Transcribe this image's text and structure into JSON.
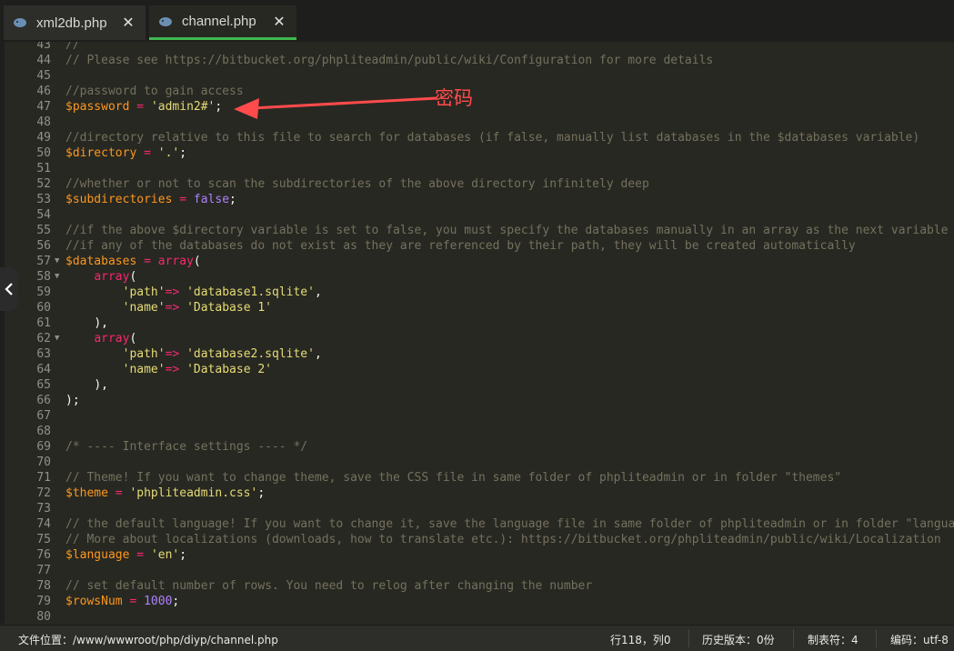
{
  "tabs": [
    {
      "label": "xml2db.php",
      "close": "✕",
      "active": false
    },
    {
      "label": "channel.php",
      "close": "✕",
      "active": true
    }
  ],
  "colors": {
    "accent": "#3fb950",
    "annotation": "#ff4b4b"
  },
  "annotation": {
    "text": "密码"
  },
  "lines": [
    {
      "n": "43",
      "fold": false,
      "segs": [
        {
          "c": "c",
          "t": "//"
        }
      ]
    },
    {
      "n": "44",
      "fold": false,
      "segs": [
        {
          "c": "c",
          "t": "// Please see https://bitbucket.org/phpliteadmin/public/wiki/Configuration for more details"
        }
      ]
    },
    {
      "n": "45",
      "fold": false,
      "segs": []
    },
    {
      "n": "46",
      "fold": false,
      "segs": [
        {
          "c": "c",
          "t": "//password to gain access"
        }
      ]
    },
    {
      "n": "47",
      "fold": false,
      "segs": [
        {
          "c": "v",
          "t": "$password"
        },
        {
          "c": "p",
          "t": " "
        },
        {
          "c": "o",
          "t": "="
        },
        {
          "c": "p",
          "t": " "
        },
        {
          "c": "s",
          "t": "'admin2#'"
        },
        {
          "c": "p",
          "t": ";"
        }
      ]
    },
    {
      "n": "48",
      "fold": false,
      "segs": []
    },
    {
      "n": "49",
      "fold": false,
      "segs": [
        {
          "c": "c",
          "t": "//directory relative to this file to search for databases (if false, manually list databases in the $databases variable)"
        }
      ]
    },
    {
      "n": "50",
      "fold": false,
      "segs": [
        {
          "c": "v",
          "t": "$directory"
        },
        {
          "c": "p",
          "t": " "
        },
        {
          "c": "o",
          "t": "="
        },
        {
          "c": "p",
          "t": " "
        },
        {
          "c": "s",
          "t": "'.'"
        },
        {
          "c": "p",
          "t": ";"
        }
      ]
    },
    {
      "n": "51",
      "fold": false,
      "segs": []
    },
    {
      "n": "52",
      "fold": false,
      "segs": [
        {
          "c": "c",
          "t": "//whether or not to scan the subdirectories of the above directory infinitely deep"
        }
      ]
    },
    {
      "n": "53",
      "fold": false,
      "segs": [
        {
          "c": "v",
          "t": "$subdirectories"
        },
        {
          "c": "p",
          "t": " "
        },
        {
          "c": "o",
          "t": "="
        },
        {
          "c": "p",
          "t": " "
        },
        {
          "c": "b",
          "t": "false"
        },
        {
          "c": "p",
          "t": ";"
        }
      ]
    },
    {
      "n": "54",
      "fold": false,
      "segs": []
    },
    {
      "n": "55",
      "fold": false,
      "segs": [
        {
          "c": "c",
          "t": "//if the above $directory variable is set to false, you must specify the databases manually in an array as the next variable"
        }
      ]
    },
    {
      "n": "56",
      "fold": false,
      "segs": [
        {
          "c": "c",
          "t": "//if any of the databases do not exist as they are referenced by their path, they will be created automatically"
        }
      ]
    },
    {
      "n": "57",
      "fold": true,
      "segs": [
        {
          "c": "v",
          "t": "$databases"
        },
        {
          "c": "p",
          "t": " "
        },
        {
          "c": "o",
          "t": "="
        },
        {
          "c": "p",
          "t": " "
        },
        {
          "c": "k",
          "t": "array"
        },
        {
          "c": "p",
          "t": "("
        }
      ]
    },
    {
      "n": "58",
      "fold": true,
      "segs": [
        {
          "c": "w",
          "t": "    "
        },
        {
          "c": "k",
          "t": "array"
        },
        {
          "c": "p",
          "t": "("
        }
      ]
    },
    {
      "n": "59",
      "fold": false,
      "segs": [
        {
          "c": "w",
          "t": "        "
        },
        {
          "c": "s",
          "t": "'path'"
        },
        {
          "c": "o",
          "t": "=>"
        },
        {
          "c": "p",
          "t": " "
        },
        {
          "c": "s",
          "t": "'database1.sqlite'"
        },
        {
          "c": "p",
          "t": ","
        }
      ]
    },
    {
      "n": "60",
      "fold": false,
      "segs": [
        {
          "c": "w",
          "t": "        "
        },
        {
          "c": "s",
          "t": "'name'"
        },
        {
          "c": "o",
          "t": "=>"
        },
        {
          "c": "p",
          "t": " "
        },
        {
          "c": "s",
          "t": "'Database 1'"
        }
      ]
    },
    {
      "n": "61",
      "fold": false,
      "segs": [
        {
          "c": "w",
          "t": "    "
        },
        {
          "c": "p",
          "t": "),"
        }
      ]
    },
    {
      "n": "62",
      "fold": true,
      "segs": [
        {
          "c": "w",
          "t": "    "
        },
        {
          "c": "k",
          "t": "array"
        },
        {
          "c": "p",
          "t": "("
        }
      ]
    },
    {
      "n": "63",
      "fold": false,
      "segs": [
        {
          "c": "w",
          "t": "        "
        },
        {
          "c": "s",
          "t": "'path'"
        },
        {
          "c": "o",
          "t": "=>"
        },
        {
          "c": "p",
          "t": " "
        },
        {
          "c": "s",
          "t": "'database2.sqlite'"
        },
        {
          "c": "p",
          "t": ","
        }
      ]
    },
    {
      "n": "64",
      "fold": false,
      "segs": [
        {
          "c": "w",
          "t": "        "
        },
        {
          "c": "s",
          "t": "'name'"
        },
        {
          "c": "o",
          "t": "=>"
        },
        {
          "c": "p",
          "t": " "
        },
        {
          "c": "s",
          "t": "'Database 2'"
        }
      ]
    },
    {
      "n": "65",
      "fold": false,
      "segs": [
        {
          "c": "w",
          "t": "    "
        },
        {
          "c": "p",
          "t": "),"
        }
      ]
    },
    {
      "n": "66",
      "fold": false,
      "segs": [
        {
          "c": "p",
          "t": ");"
        }
      ]
    },
    {
      "n": "67",
      "fold": false,
      "segs": []
    },
    {
      "n": "68",
      "fold": false,
      "segs": []
    },
    {
      "n": "69",
      "fold": false,
      "segs": [
        {
          "c": "c",
          "t": "/* ---- Interface settings ---- */"
        }
      ]
    },
    {
      "n": "70",
      "fold": false,
      "segs": []
    },
    {
      "n": "71",
      "fold": false,
      "segs": [
        {
          "c": "c",
          "t": "// Theme! If you want to change theme, save the CSS file in same folder of phpliteadmin or in folder \"themes\""
        }
      ]
    },
    {
      "n": "72",
      "fold": false,
      "segs": [
        {
          "c": "v",
          "t": "$theme"
        },
        {
          "c": "p",
          "t": " "
        },
        {
          "c": "o",
          "t": "="
        },
        {
          "c": "p",
          "t": " "
        },
        {
          "c": "s",
          "t": "'phpliteadmin.css'"
        },
        {
          "c": "p",
          "t": ";"
        }
      ]
    },
    {
      "n": "73",
      "fold": false,
      "segs": []
    },
    {
      "n": "74",
      "fold": false,
      "segs": [
        {
          "c": "c",
          "t": "// the default language! If you want to change it, save the language file in same folder of phpliteadmin or in folder \"language"
        }
      ]
    },
    {
      "n": "75",
      "fold": false,
      "segs": [
        {
          "c": "c",
          "t": "// More about localizations (downloads, how to translate etc.): https://bitbucket.org/phpliteadmin/public/wiki/Localization"
        }
      ]
    },
    {
      "n": "76",
      "fold": false,
      "segs": [
        {
          "c": "v",
          "t": "$language"
        },
        {
          "c": "p",
          "t": " "
        },
        {
          "c": "o",
          "t": "="
        },
        {
          "c": "p",
          "t": " "
        },
        {
          "c": "s",
          "t": "'en'"
        },
        {
          "c": "p",
          "t": ";"
        }
      ]
    },
    {
      "n": "77",
      "fold": false,
      "segs": []
    },
    {
      "n": "78",
      "fold": false,
      "segs": [
        {
          "c": "c",
          "t": "// set default number of rows. You need to relog after changing the number"
        }
      ]
    },
    {
      "n": "79",
      "fold": false,
      "segs": [
        {
          "c": "v",
          "t": "$rowsNum"
        },
        {
          "c": "p",
          "t": " "
        },
        {
          "c": "o",
          "t": "="
        },
        {
          "c": "p",
          "t": " "
        },
        {
          "c": "b",
          "t": "1000"
        },
        {
          "c": "p",
          "t": ";"
        }
      ]
    },
    {
      "n": "80",
      "fold": false,
      "segs": []
    }
  ],
  "status": {
    "file_location": "文件位置：/www/wwwroot/php/diyp/channel.php",
    "cursor": "行118，列0",
    "history": "历史版本：0份",
    "tab_size": "制表符：4",
    "encoding": "编码：utf-8"
  }
}
